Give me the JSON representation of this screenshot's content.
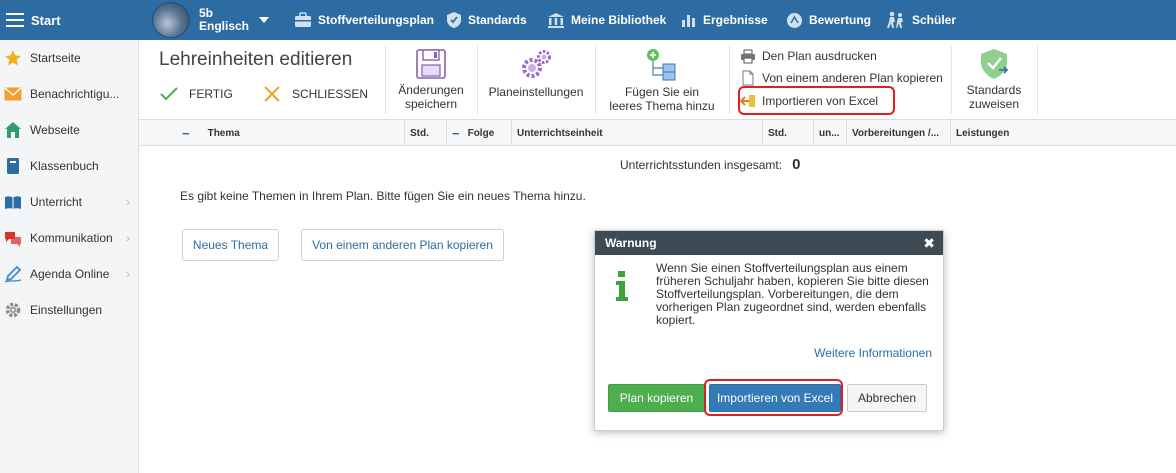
{
  "topbar": {
    "start_label": "Start",
    "class_line1": "5b",
    "class_line2": "Englisch",
    "nav": [
      {
        "label": "Stoffverteilungsplan",
        "icon": "briefcase-icon"
      },
      {
        "label": "Standards",
        "icon": "shield-icon"
      },
      {
        "label": "Meine Bibliothek",
        "icon": "library-icon"
      },
      {
        "label": "Ergebnisse",
        "icon": "bar-chart-icon"
      },
      {
        "label": "Bewertung",
        "icon": "grade-icon"
      },
      {
        "label": "Schüler",
        "icon": "students-icon"
      }
    ]
  },
  "sidebar": {
    "items": [
      {
        "label": "Startseite",
        "icon": "star-icon",
        "color": "#f2b01e"
      },
      {
        "label": "Benachrichtigu...",
        "icon": "envelope-icon",
        "color": "#f0a030"
      },
      {
        "label": "Webseite",
        "icon": "home-icon",
        "color": "#2e9e6b"
      },
      {
        "label": "Klassenbuch",
        "icon": "book-icon",
        "color": "#2d6ca2"
      },
      {
        "label": "Unterricht",
        "icon": "open-book-icon",
        "color": "#2d6ca2"
      },
      {
        "label": "Kommunikation",
        "icon": "chat-icon",
        "color": "#d9342b"
      },
      {
        "label": "Agenda Online",
        "icon": "pen-icon",
        "color": "#3a8fd6"
      },
      {
        "label": "Einstellungen",
        "icon": "gear-icon",
        "color": "#8a8a8a"
      }
    ]
  },
  "ribbon": {
    "title": "Lehreinheiten editieren",
    "done_label": "FERTIG",
    "close_label": "SCHLIESSEN",
    "save_line1": "Änderungen",
    "save_line2": "speichern",
    "settings_label": "Planeinstellungen",
    "add_line1": "Fügen Sie ein",
    "add_line2": "leeres Thema hinzu",
    "print_label": "Den Plan ausdrucken",
    "copy_label": "Von einem anderen Plan kopieren",
    "import_label": "Importieren von Excel",
    "standards_line1": "Standards",
    "standards_line2": "zuweisen"
  },
  "table": {
    "headers": {
      "minus1": "−",
      "thema": "Thema",
      "std1": "Std.",
      "minus2": "−",
      "folge": "Folge",
      "einheit": "Unterrichtseinheit",
      "std2": "Std.",
      "un": "un...",
      "vorb": "Vorbereitungen /...",
      "leist": "Leistungen"
    }
  },
  "main": {
    "total_label": "Unterrichtsstunden insgesamt:",
    "total_value": "0",
    "empty_msg": "Es gibt keine Themen in Ihrem Plan. Bitte fügen Sie ein neues Thema hinzu.",
    "new_theme_btn": "Neues Thema",
    "copy_plan_btn": "Von einem anderen Plan kopieren"
  },
  "dialog": {
    "title": "Warnung",
    "close": "✖",
    "message": "Wenn Sie einen Stoffverteilungsplan aus einem früheren Schuljahr haben, kopieren Sie bitte diesen Stoffverteilungsplan. Vorbereitungen, die dem vorherigen Plan zugeordnet sind, werden ebenfalls kopiert.",
    "more_info": "Weitere Informationen",
    "btn_copy": "Plan kopieren",
    "btn_import": "Importieren von Excel",
    "btn_cancel": "Abbrechen"
  },
  "colors": {
    "topbar": "#2d6ca2",
    "accent_green": "#4cae4c",
    "accent_blue": "#337ab7",
    "highlight": "#e02020"
  }
}
